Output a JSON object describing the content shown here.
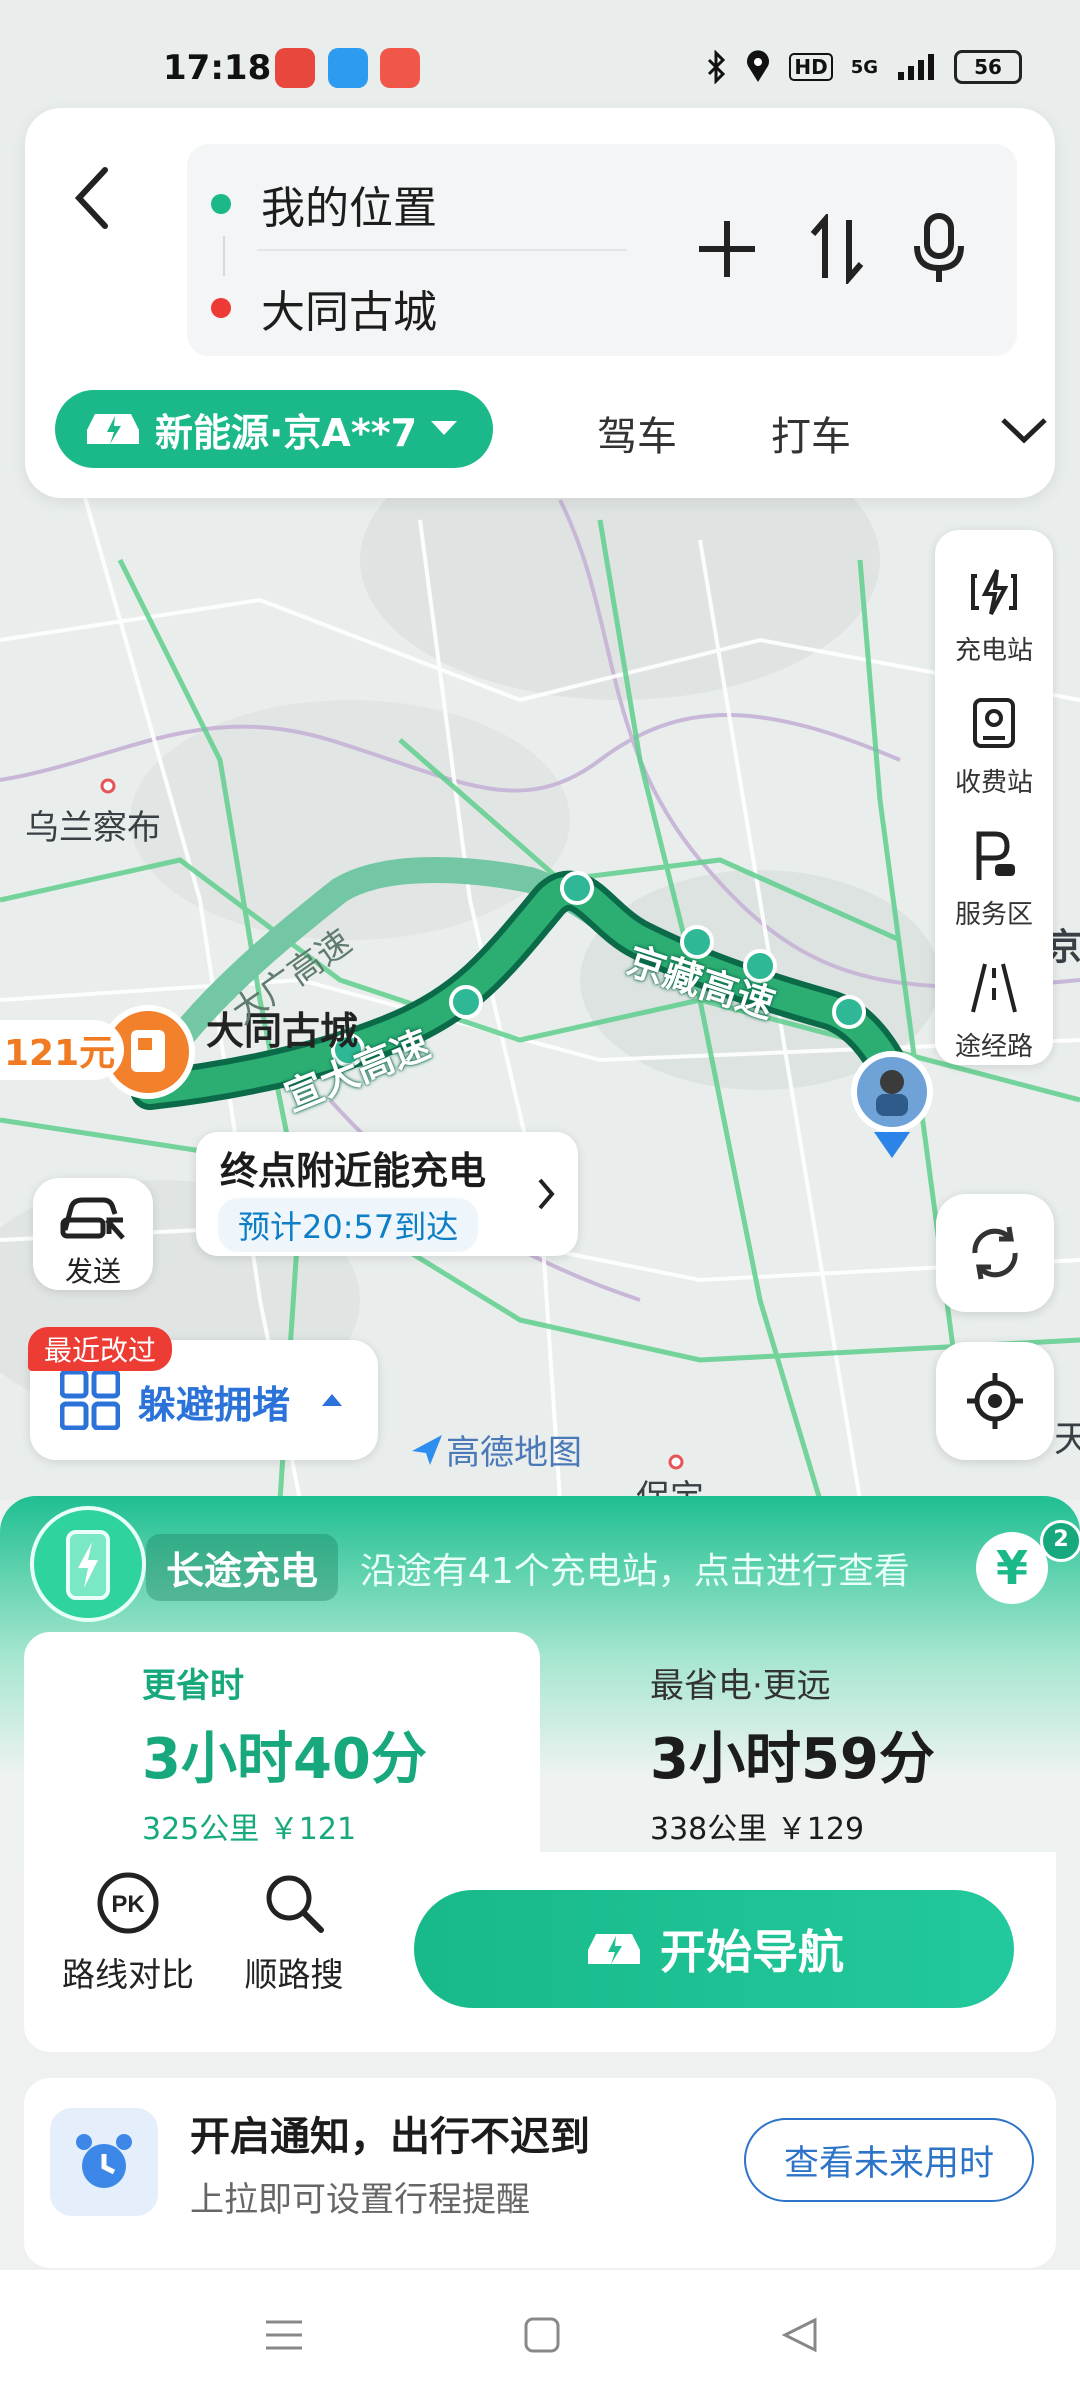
{
  "status_bar": {
    "time": "17:18",
    "network": "5G",
    "battery": "56",
    "icons": [
      "bluetooth-icon",
      "location-icon",
      "hd-icon",
      "signal-icon"
    ]
  },
  "search": {
    "origin": "我的位置",
    "destination": "大同古城",
    "origin_dot_color": "#1bb98a",
    "destination_dot_color": "#ee3a35"
  },
  "modes": {
    "vehicle": "新能源·京A**7",
    "drive": "驾车",
    "taxi": "打车",
    "accent": "#1bb98a"
  },
  "map": {
    "place_labels": [
      "乌兰察布",
      "大同古城",
      "保定"
    ],
    "road_labels": [
      "宣大高速",
      "京藏高速",
      "大广高速"
    ],
    "price_tag": "121元",
    "destination_callout": {
      "title": "终点附近能充电",
      "eta": "预计20:57到达"
    },
    "send_label": "发送",
    "recent_badge": "最近改过",
    "avoid_label": "躲避拥堵",
    "brand": "高德地图",
    "edge_labels": [
      "京",
      "天"
    ]
  },
  "map_tools": [
    "充电站",
    "收费站",
    "服务区",
    "途经路"
  ],
  "long_charge": {
    "title": "长途充电",
    "description": "沿途有41个充电站，点击进行查看",
    "coupon_symbol": "¥",
    "coupon_count": "2"
  },
  "route_options": [
    {
      "label": "更省时",
      "time": "3小时40分",
      "meta": "325公里 ￥121"
    },
    {
      "label": "最省电·更远",
      "time": "3小时59分",
      "meta": "338公里 ￥129"
    }
  ],
  "actions": {
    "compare": "路线对比",
    "along_search": "顺路搜",
    "start": "开始导航"
  },
  "notify": {
    "title": "开启通知，出行不迟到",
    "subtitle": "上拉即可设置行程提醒",
    "button": "查看未来用时"
  }
}
